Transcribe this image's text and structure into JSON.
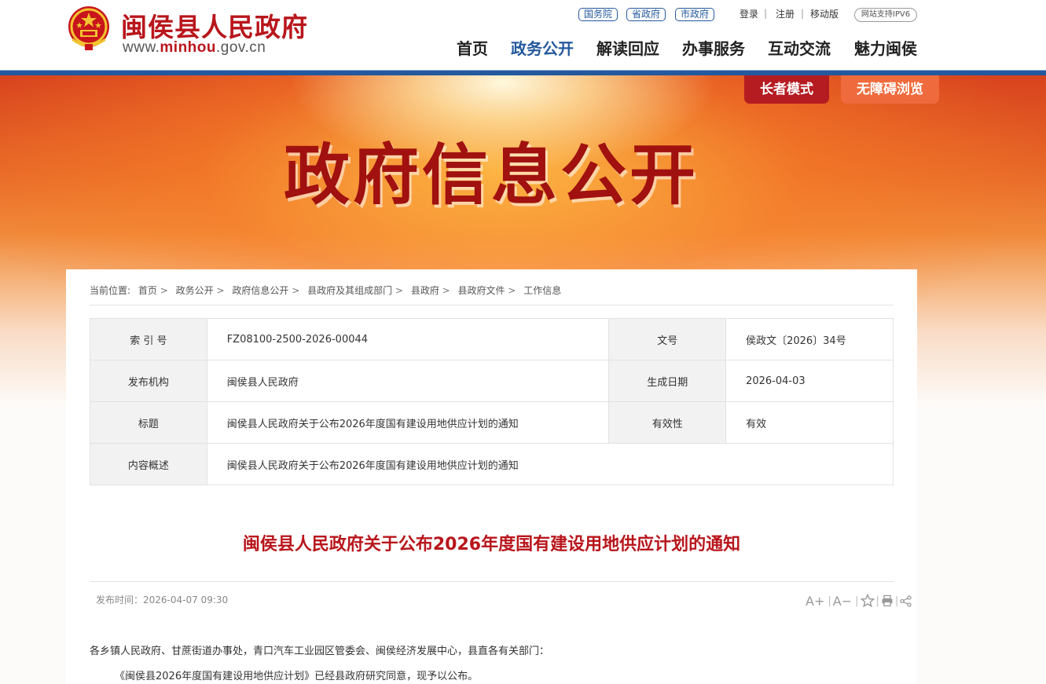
{
  "header": {
    "site_name": "闽侯县人民政府",
    "site_url_prefix": "www.",
    "site_url_highlight": "minhou",
    "site_url_suffix": ".gov.cn",
    "gov_links": [
      "国务院",
      "省政府",
      "市政府"
    ],
    "user_links": [
      "登录",
      "注册",
      "移动版"
    ],
    "ipv6_badge": "网站支持IPV6",
    "nav": [
      "首页",
      "政务公开",
      "解读回应",
      "办事服务",
      "互动交流",
      "魅力闽侯"
    ],
    "active_nav": "政务公开"
  },
  "banner": {
    "title": "政府信息公开",
    "elder_mode": "长者模式",
    "accessible_mode": "无障碍浏览"
  },
  "breadcrumb": {
    "prefix": "当前位置:",
    "items": [
      "首页",
      "政务公开",
      "政府信息公开",
      "县政府及其组成部门",
      "县政府",
      "县政府文件",
      "工作信息"
    ],
    "separator": ">"
  },
  "meta_table": {
    "index_no_label": "索 引 号",
    "index_no": "FZ08100-2500-2026-00044",
    "doc_no_label": "文号",
    "doc_no": "侯政文〔2026〕34号",
    "publisher_label": "发布机构",
    "publisher": "闽侯县人民政府",
    "created_date_label": "生成日期",
    "created_date": "2026-04-03",
    "title_label": "标题",
    "title": "闽侯县人民政府关于公布2026年度国有建设用地供应计划的通知",
    "validity_label": "有效性",
    "validity": "有效",
    "summary_label": "内容概述",
    "summary": "闽侯县人民政府关于公布2026年度国有建设用地供应计划的通知"
  },
  "article": {
    "title": "闽侯县人民政府关于公布2026年度国有建设用地供应计划的通知",
    "publish_time": "发布时间：2026-04-07 09:30",
    "font_larger": "A+",
    "font_smaller": "A−",
    "paragraphs": [
      "各乡镇人民政府、甘蔗街道办事处，青口汽车工业园区管委会、闽侯经济发展中心，县直各有关部门：",
      "《闽侯县2026年度国有建设用地供应计划》已经县政府研究同意，现予以公布。"
    ]
  },
  "colors": {
    "brand_red": "#b8161c",
    "nav_blue": "#24599d",
    "elder_btn": "#b51c21",
    "access_btn": "#ef6a3c"
  },
  "icons": [
    "national-emblem-icon",
    "favorite-star-icon",
    "print-icon",
    "share-icon"
  ]
}
